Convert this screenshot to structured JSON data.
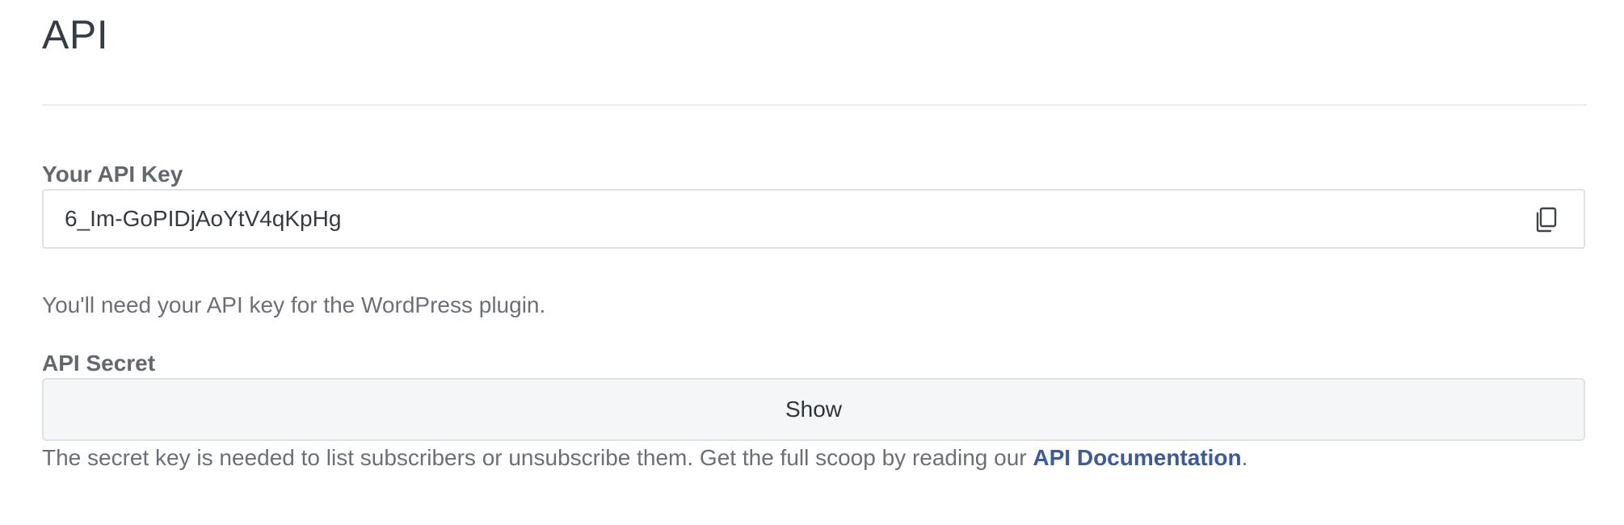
{
  "page": {
    "title": "API"
  },
  "api_key": {
    "label": "Your API Key",
    "value": "6_Im-GoPIDjAoYtV4qKpHg",
    "copy_icon": "copy-icon",
    "help_text": "You'll need your API key for the WordPress plugin."
  },
  "api_secret": {
    "label": "API Secret",
    "show_label": "Show",
    "help_text_before": "The secret key is needed to list subscribers or unsubscribe them. Get the full scoop by reading our ",
    "docs_link": "API Documentation",
    "help_text_after": "."
  },
  "colors": {
    "link": "#3d5a99",
    "border": "#dfe1e5",
    "button_bg": "#f5f6f8",
    "muted_text": "#6b7078"
  }
}
